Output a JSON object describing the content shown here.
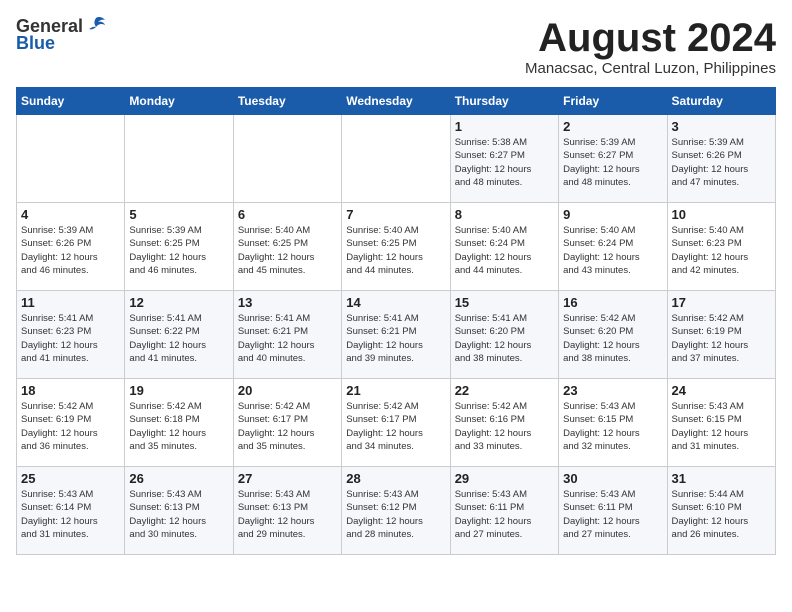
{
  "header": {
    "logo_general": "General",
    "logo_blue": "Blue",
    "month": "August 2024",
    "location": "Manacsac, Central Luzon, Philippines"
  },
  "weekdays": [
    "Sunday",
    "Monday",
    "Tuesday",
    "Wednesday",
    "Thursday",
    "Friday",
    "Saturday"
  ],
  "weeks": [
    [
      {
        "day": "",
        "info": ""
      },
      {
        "day": "",
        "info": ""
      },
      {
        "day": "",
        "info": ""
      },
      {
        "day": "",
        "info": ""
      },
      {
        "day": "1",
        "info": "Sunrise: 5:38 AM\nSunset: 6:27 PM\nDaylight: 12 hours\nand 48 minutes."
      },
      {
        "day": "2",
        "info": "Sunrise: 5:39 AM\nSunset: 6:27 PM\nDaylight: 12 hours\nand 48 minutes."
      },
      {
        "day": "3",
        "info": "Sunrise: 5:39 AM\nSunset: 6:26 PM\nDaylight: 12 hours\nand 47 minutes."
      }
    ],
    [
      {
        "day": "4",
        "info": "Sunrise: 5:39 AM\nSunset: 6:26 PM\nDaylight: 12 hours\nand 46 minutes."
      },
      {
        "day": "5",
        "info": "Sunrise: 5:39 AM\nSunset: 6:25 PM\nDaylight: 12 hours\nand 46 minutes."
      },
      {
        "day": "6",
        "info": "Sunrise: 5:40 AM\nSunset: 6:25 PM\nDaylight: 12 hours\nand 45 minutes."
      },
      {
        "day": "7",
        "info": "Sunrise: 5:40 AM\nSunset: 6:25 PM\nDaylight: 12 hours\nand 44 minutes."
      },
      {
        "day": "8",
        "info": "Sunrise: 5:40 AM\nSunset: 6:24 PM\nDaylight: 12 hours\nand 44 minutes."
      },
      {
        "day": "9",
        "info": "Sunrise: 5:40 AM\nSunset: 6:24 PM\nDaylight: 12 hours\nand 43 minutes."
      },
      {
        "day": "10",
        "info": "Sunrise: 5:40 AM\nSunset: 6:23 PM\nDaylight: 12 hours\nand 42 minutes."
      }
    ],
    [
      {
        "day": "11",
        "info": "Sunrise: 5:41 AM\nSunset: 6:23 PM\nDaylight: 12 hours\nand 41 minutes."
      },
      {
        "day": "12",
        "info": "Sunrise: 5:41 AM\nSunset: 6:22 PM\nDaylight: 12 hours\nand 41 minutes."
      },
      {
        "day": "13",
        "info": "Sunrise: 5:41 AM\nSunset: 6:21 PM\nDaylight: 12 hours\nand 40 minutes."
      },
      {
        "day": "14",
        "info": "Sunrise: 5:41 AM\nSunset: 6:21 PM\nDaylight: 12 hours\nand 39 minutes."
      },
      {
        "day": "15",
        "info": "Sunrise: 5:41 AM\nSunset: 6:20 PM\nDaylight: 12 hours\nand 38 minutes."
      },
      {
        "day": "16",
        "info": "Sunrise: 5:42 AM\nSunset: 6:20 PM\nDaylight: 12 hours\nand 38 minutes."
      },
      {
        "day": "17",
        "info": "Sunrise: 5:42 AM\nSunset: 6:19 PM\nDaylight: 12 hours\nand 37 minutes."
      }
    ],
    [
      {
        "day": "18",
        "info": "Sunrise: 5:42 AM\nSunset: 6:19 PM\nDaylight: 12 hours\nand 36 minutes."
      },
      {
        "day": "19",
        "info": "Sunrise: 5:42 AM\nSunset: 6:18 PM\nDaylight: 12 hours\nand 35 minutes."
      },
      {
        "day": "20",
        "info": "Sunrise: 5:42 AM\nSunset: 6:17 PM\nDaylight: 12 hours\nand 35 minutes."
      },
      {
        "day": "21",
        "info": "Sunrise: 5:42 AM\nSunset: 6:17 PM\nDaylight: 12 hours\nand 34 minutes."
      },
      {
        "day": "22",
        "info": "Sunrise: 5:42 AM\nSunset: 6:16 PM\nDaylight: 12 hours\nand 33 minutes."
      },
      {
        "day": "23",
        "info": "Sunrise: 5:43 AM\nSunset: 6:15 PM\nDaylight: 12 hours\nand 32 minutes."
      },
      {
        "day": "24",
        "info": "Sunrise: 5:43 AM\nSunset: 6:15 PM\nDaylight: 12 hours\nand 31 minutes."
      }
    ],
    [
      {
        "day": "25",
        "info": "Sunrise: 5:43 AM\nSunset: 6:14 PM\nDaylight: 12 hours\nand 31 minutes."
      },
      {
        "day": "26",
        "info": "Sunrise: 5:43 AM\nSunset: 6:13 PM\nDaylight: 12 hours\nand 30 minutes."
      },
      {
        "day": "27",
        "info": "Sunrise: 5:43 AM\nSunset: 6:13 PM\nDaylight: 12 hours\nand 29 minutes."
      },
      {
        "day": "28",
        "info": "Sunrise: 5:43 AM\nSunset: 6:12 PM\nDaylight: 12 hours\nand 28 minutes."
      },
      {
        "day": "29",
        "info": "Sunrise: 5:43 AM\nSunset: 6:11 PM\nDaylight: 12 hours\nand 27 minutes."
      },
      {
        "day": "30",
        "info": "Sunrise: 5:43 AM\nSunset: 6:11 PM\nDaylight: 12 hours\nand 27 minutes."
      },
      {
        "day": "31",
        "info": "Sunrise: 5:44 AM\nSunset: 6:10 PM\nDaylight: 12 hours\nand 26 minutes."
      }
    ]
  ]
}
